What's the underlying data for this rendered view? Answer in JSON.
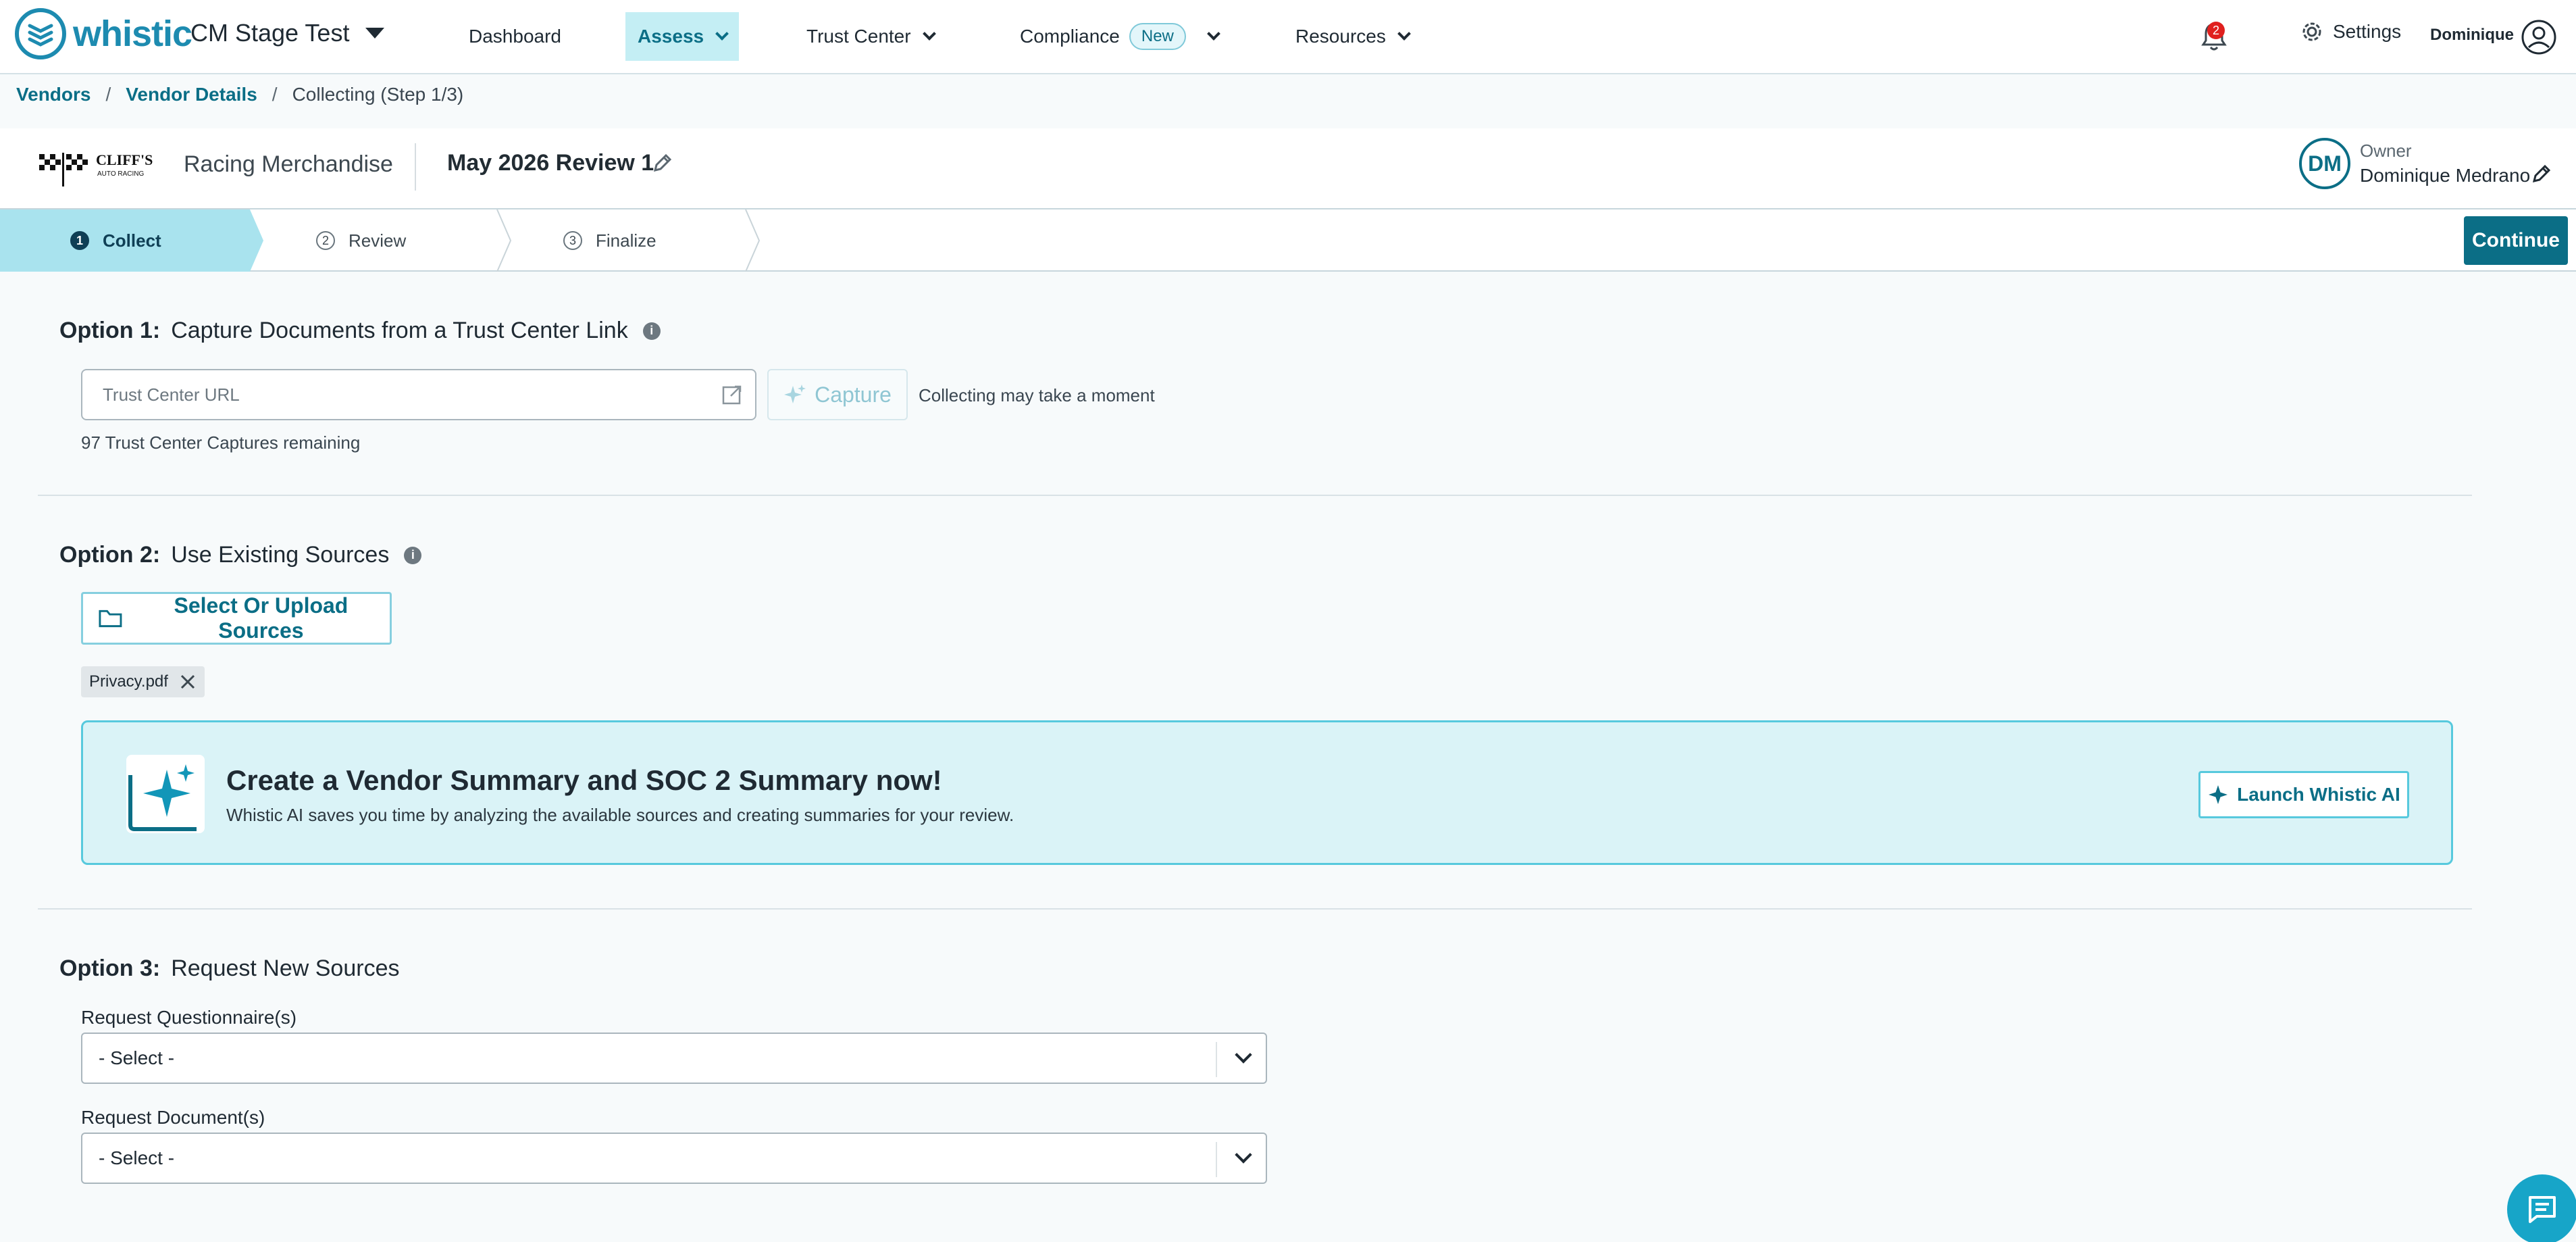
{
  "nav": {
    "logo_text": "whistic",
    "org_name": "CM Stage Test",
    "items": [
      {
        "label": "Dashboard"
      },
      {
        "label": "Assess"
      },
      {
        "label": "Trust Center"
      },
      {
        "label": "Compliance",
        "badge": "New"
      },
      {
        "label": "Resources"
      }
    ],
    "notification_count": "2",
    "settings_label": "Settings",
    "user_name": "Dominique"
  },
  "breadcrumb": {
    "items": [
      "Vendors",
      "Vendor Details"
    ],
    "current": "Collecting (Step 1/3)"
  },
  "vendor": {
    "logo_text": "CLIFF'S",
    "logo_subtext": "AUTO RACING",
    "name": "Racing Merchandise",
    "review_name": "May 2026 Review 1",
    "owner_initials": "DM",
    "owner_label": "Owner",
    "owner_name": "Dominique Medrano"
  },
  "stepper": {
    "steps": [
      {
        "num": "1",
        "label": "Collect",
        "active": true
      },
      {
        "num": "2",
        "label": "Review",
        "active": false
      },
      {
        "num": "3",
        "label": "Finalize",
        "active": false
      }
    ],
    "continue_label": "Continue"
  },
  "option1": {
    "prefix": "Option 1:",
    "title": "Capture Documents from a Trust Center Link",
    "input_placeholder": "Trust Center URL",
    "capture_label": "Capture",
    "note": "Collecting may take a moment",
    "remaining": "97 Trust Center Captures remaining"
  },
  "option2": {
    "prefix": "Option 2:",
    "title": "Use Existing Sources",
    "upload_label": "Select Or Upload Sources",
    "files": [
      "Privacy.pdf"
    ],
    "ai_banner": {
      "title": "Create a Vendor Summary and SOC 2 Summary now!",
      "subtitle": "Whistic AI saves you time by analyzing the available sources and creating summaries for your review.",
      "button_label": "Launch Whistic AI"
    }
  },
  "option3": {
    "prefix": "Option 3:",
    "title": "Request New Sources",
    "questionnaire_label": "Request Questionnaire(s)",
    "questionnaire_value": "- Select -",
    "document_label": "Request Document(s)",
    "document_value": "- Select -"
  },
  "colors": {
    "brand": "#0b6e86",
    "accent_light": "#c4eef4",
    "banner_bg": "#daf3f7",
    "badge_red": "#e0201e"
  }
}
